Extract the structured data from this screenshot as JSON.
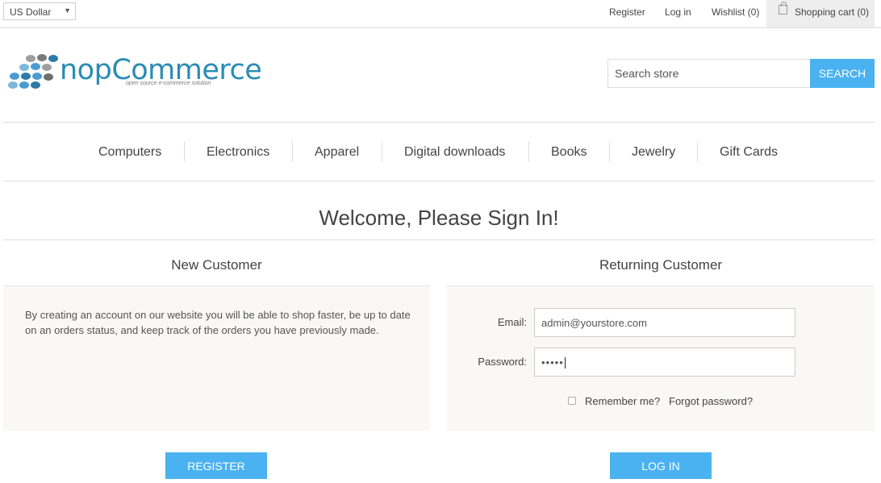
{
  "header": {
    "currency": "US Dollar",
    "links": {
      "register": "Register",
      "login": "Log in",
      "wishlist": "Wishlist (0)",
      "cart": "Shopping cart (0)"
    }
  },
  "logo": {
    "name": "nopCommerce",
    "tagline": "open source e-commerce solution",
    "dot_colors": [
      "#4a9bd0",
      "#7ab8de",
      "#9e9e9e",
      "#2f79a8",
      "#4a9bd0",
      "#6e6e6e"
    ]
  },
  "search": {
    "placeholder": "Search store",
    "button": "SEARCH"
  },
  "menu": [
    "Computers",
    "Electronics",
    "Apparel",
    "Digital downloads",
    "Books",
    "Jewelry",
    "Gift Cards"
  ],
  "page": {
    "title": "Welcome, Please Sign In!"
  },
  "new_customer": {
    "title": "New Customer",
    "text": "By creating an account on our website you will be able to shop faster, be up to date on an orders status, and keep track of the orders you have previously made.",
    "button": "REGISTER"
  },
  "returning_customer": {
    "title": "Returning Customer",
    "email_label": "Email:",
    "email_value": "admin@yourstore.com",
    "password_label": "Password:",
    "password_value": "•••••",
    "remember_label": "Remember me?",
    "forgot_label": "Forgot password?",
    "button": "LOG IN"
  },
  "colors": {
    "accent": "#4ab2f1",
    "panel_bg": "#f9f8f6",
    "logo_blue": "#2a8cb4"
  }
}
